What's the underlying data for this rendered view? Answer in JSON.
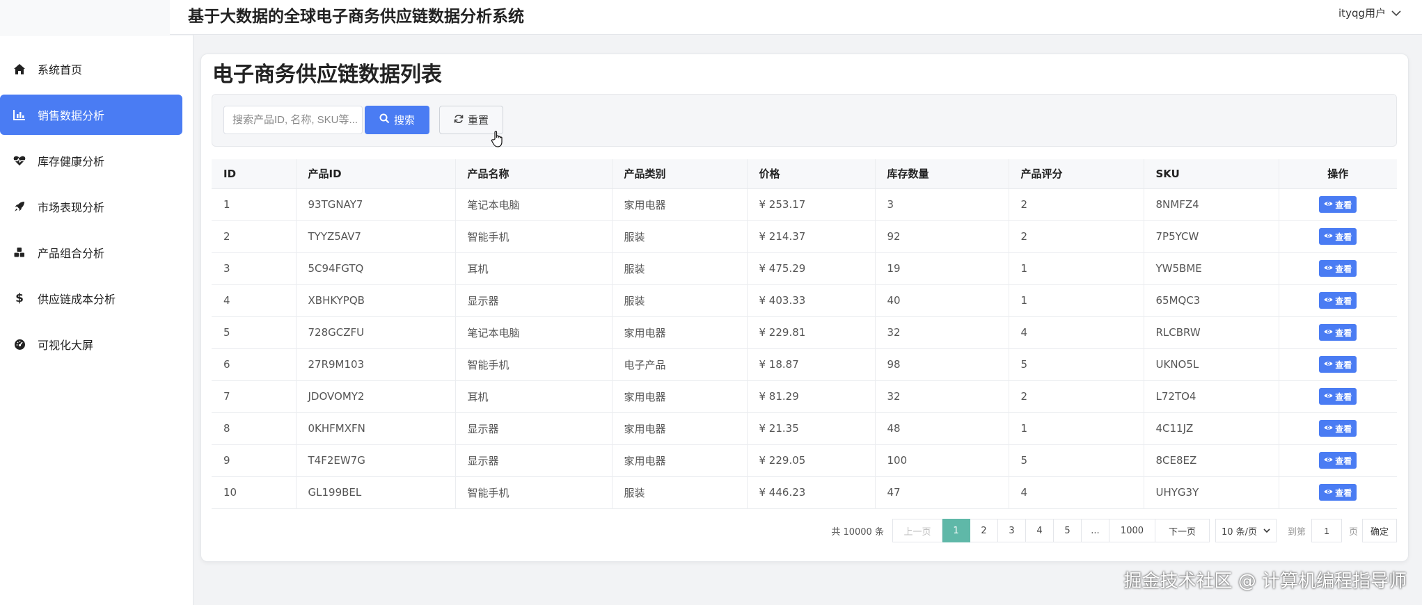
{
  "header": {
    "title": "基于大数据的全球电子商务供应链数据分析系统",
    "user": "ityqg用户"
  },
  "sidebar": {
    "items": [
      {
        "label": "系统首页",
        "icon": "home-icon"
      },
      {
        "label": "销售数据分析",
        "icon": "bar-chart-icon",
        "active": true
      },
      {
        "label": "库存健康分析",
        "icon": "heartbeat-icon"
      },
      {
        "label": "市场表现分析",
        "icon": "rocket-icon"
      },
      {
        "label": "产品组合分析",
        "icon": "cubes-icon"
      },
      {
        "label": "供应链成本分析",
        "icon": "dollar-icon"
      },
      {
        "label": "可视化大屏",
        "icon": "dashboard-icon"
      }
    ]
  },
  "main": {
    "page_title": "电子商务供应链数据列表",
    "search": {
      "placeholder": "搜索产品ID, 名称, SKU等...",
      "search_label": "搜索",
      "reset_label": "重置"
    },
    "table": {
      "columns": [
        "ID",
        "产品ID",
        "产品名称",
        "产品类别",
        "价格",
        "库存数量",
        "产品评分",
        "SKU",
        "操作"
      ],
      "rows": [
        [
          "1",
          "93TGNAY7",
          "笔记本电脑",
          "家用电器",
          "¥ 253.17",
          "3",
          "2",
          "8NMFZ4"
        ],
        [
          "2",
          "TYYZ5AV7",
          "智能手机",
          "服装",
          "¥ 214.37",
          "92",
          "2",
          "7P5YCW"
        ],
        [
          "3",
          "5C94FGTQ",
          "耳机",
          "服装",
          "¥ 475.29",
          "19",
          "1",
          "YW5BME"
        ],
        [
          "4",
          "XBHKYPQB",
          "显示器",
          "服装",
          "¥ 403.33",
          "40",
          "1",
          "65MQC3"
        ],
        [
          "5",
          "728GCZFU",
          "笔记本电脑",
          "家用电器",
          "¥ 229.81",
          "32",
          "4",
          "RLCBRW"
        ],
        [
          "6",
          "27R9M103",
          "智能手机",
          "电子产品",
          "¥ 18.87",
          "98",
          "5",
          "UKNO5L"
        ],
        [
          "7",
          "JDOVOMY2",
          "耳机",
          "家用电器",
          "¥ 81.29",
          "32",
          "2",
          "L72TO4"
        ],
        [
          "8",
          "0KHFMXFN",
          "显示器",
          "家用电器",
          "¥ 21.35",
          "48",
          "1",
          "4C11JZ"
        ],
        [
          "9",
          "T4F2EW7G",
          "显示器",
          "家用电器",
          "¥ 229.05",
          "100",
          "5",
          "8CE8EZ"
        ],
        [
          "10",
          "GL199BEL",
          "智能手机",
          "服装",
          "¥ 446.23",
          "47",
          "4",
          "UHYG3Y"
        ]
      ],
      "view_label": "查看"
    },
    "pagination": {
      "total": "共 10000 条",
      "prev": "上一页",
      "pages": [
        "1",
        "2",
        "3",
        "4",
        "5",
        "...",
        "1000"
      ],
      "current": "1",
      "next": "下一页",
      "page_size": "10 条/页",
      "jump_label": "到第",
      "jump_value": "1",
      "page_suffix": "页",
      "confirm": "确定"
    }
  },
  "watermark": "掘金技术社区 @ 计算机编程指导师",
  "colors": {
    "primary": "#4a7cf3",
    "current_page": "#5fb8a8"
  }
}
